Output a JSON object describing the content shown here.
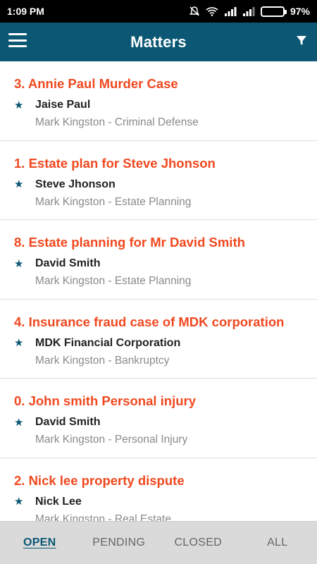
{
  "status_bar": {
    "time": "1:09 PM",
    "battery": "97%",
    "icons": [
      "mute-icon",
      "wifi-icon",
      "signal-icon",
      "signal-icon",
      "battery-icon"
    ]
  },
  "app_bar": {
    "title": "Matters",
    "menu_icon": "hamburger-menu-icon",
    "filter_icon": "filter-icon",
    "color": "#0b5774"
  },
  "matters": [
    {
      "title": "3. Annie Paul Murder Case",
      "client": "Jaise Paul",
      "detail": "Mark Kingston - Criminal Defense"
    },
    {
      "title": "1. Estate plan for Steve Jhonson",
      "client": "Steve Jhonson",
      "detail": "Mark Kingston - Estate Planning"
    },
    {
      "title": "8. Estate planning for Mr David Smith",
      "client": "David Smith",
      "detail": "Mark Kingston - Estate Planning"
    },
    {
      "title": "4. Insurance fraud case of MDK corporation",
      "client": "MDK Financial Corporation",
      "detail": "Mark Kingston - Bankruptcy"
    },
    {
      "title": "0. John smith Personal injury",
      "client": "David Smith",
      "detail": "Mark Kingston - Personal Injury"
    },
    {
      "title": "2. Nick lee property dispute",
      "client": "Nick Lee",
      "detail": "Mark Kingston - Real Estate"
    }
  ],
  "tabs": [
    {
      "label": "OPEN",
      "active": true
    },
    {
      "label": "PENDING",
      "active": false
    },
    {
      "label": "CLOSED",
      "active": false
    },
    {
      "label": "ALL",
      "active": false
    }
  ],
  "colors": {
    "accent": "#f0481f",
    "primary": "#0b5774",
    "tab_bar": "#dadada"
  }
}
